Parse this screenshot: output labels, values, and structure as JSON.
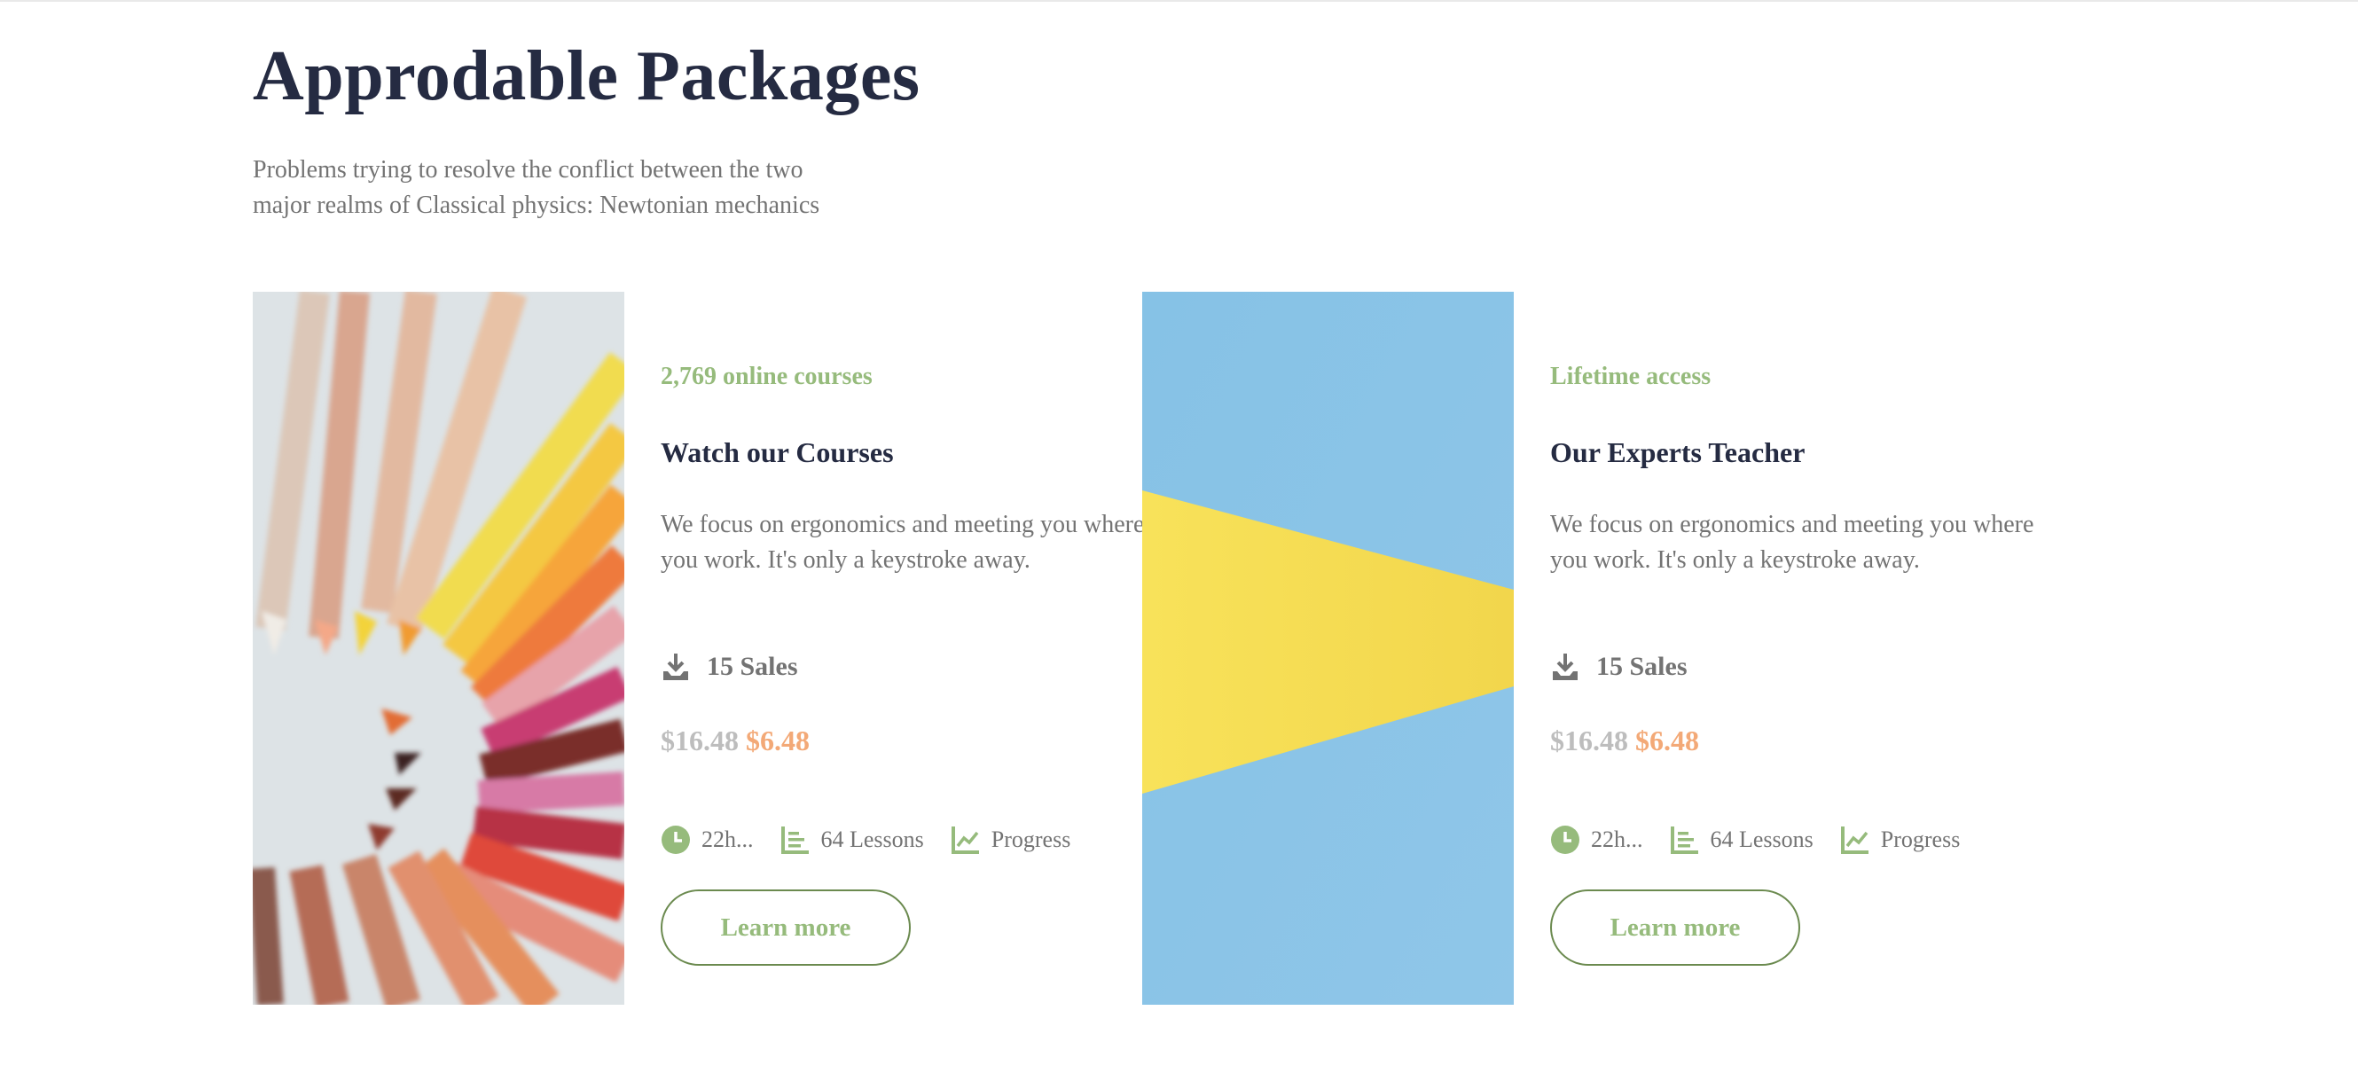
{
  "header": {
    "title": "Approdable Packages",
    "subtitle": "Problems trying to resolve the conflict between the two major realms of Classical physics: Newtonian mechanics"
  },
  "cards": [
    {
      "image": "colored-pencils-photo",
      "tag": "2,769 online courses",
      "title": "Watch our Courses",
      "description": "We focus on ergonomics and meeting you where you work. It's only a keystroke away.",
      "sales": "15 Sales",
      "price_old": "$16.48",
      "price_new": "$6.48",
      "meta": {
        "duration": "22h...",
        "lessons": "64 Lessons",
        "progress": "Progress"
      },
      "button": "Learn more"
    },
    {
      "image": "yellow-shape-on-blue-photo",
      "tag": "Lifetime access",
      "title": "Our Experts Teacher",
      "description": "We focus on ergonomics and meeting you where you work. It's only a keystroke away.",
      "sales": "15 Sales",
      "price_old": "$16.48",
      "price_new": "$6.48",
      "meta": {
        "duration": "22h...",
        "lessons": "64 Lessons",
        "progress": "Progress"
      },
      "button": "Learn more"
    }
  ],
  "colors": {
    "title": "#252b42",
    "text": "#737373",
    "accent_green": "#96bb7c",
    "price_old": "#bdbdbd",
    "price_new": "#f3a977"
  },
  "icons": [
    "download-icon",
    "clock-icon",
    "lessons-icon",
    "progress-chart-icon"
  ]
}
